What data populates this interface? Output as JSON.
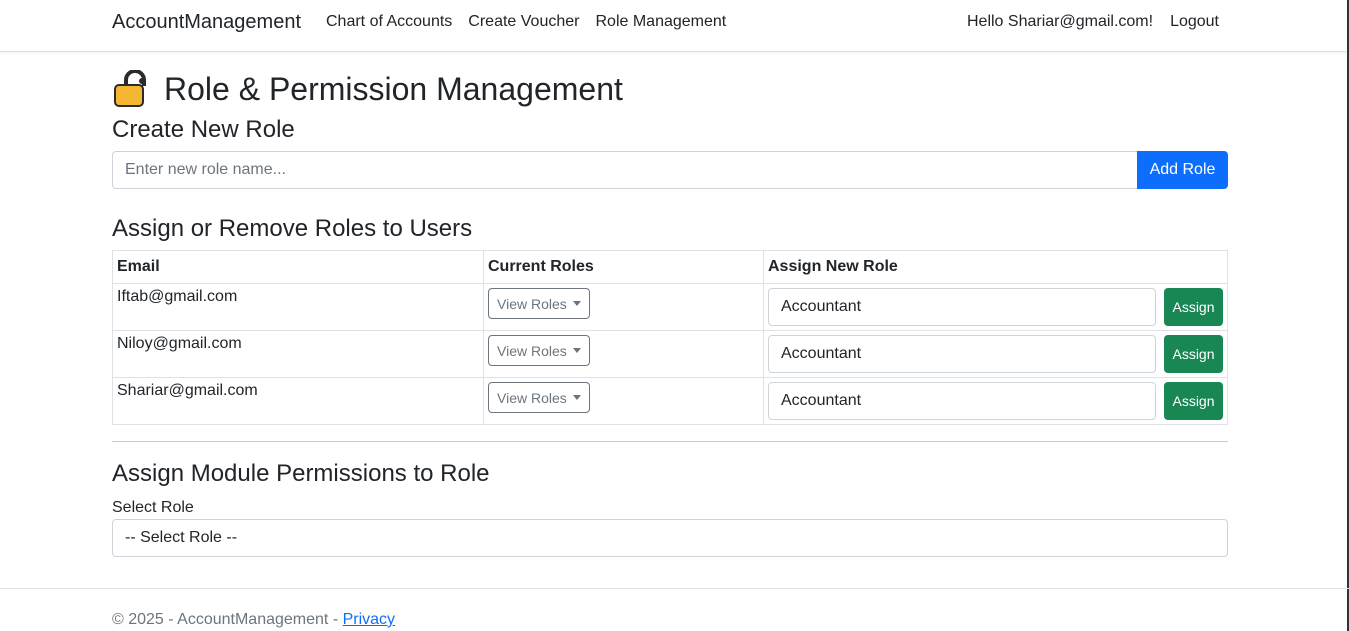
{
  "nav": {
    "brand": "AccountManagement",
    "links": [
      "Chart of Accounts",
      "Create Voucher",
      "Role Management"
    ],
    "greeting": "Hello Shariar@gmail.com!",
    "logout": "Logout"
  },
  "page": {
    "title": "Role & Permission Management",
    "icon": "lock-icon"
  },
  "create_role": {
    "heading": "Create New Role",
    "placeholder": "Enter new role name...",
    "button": "Add Role"
  },
  "assign": {
    "heading": "Assign or Remove Roles to Users",
    "columns": [
      "Email",
      "Current Roles",
      "Assign New Role"
    ],
    "rows": [
      {
        "email": "Iftab@gmail.com",
        "roles_button": "View Roles",
        "selected_role": "Accountant",
        "assign_button": "Assign"
      },
      {
        "email": "Niloy@gmail.com",
        "roles_button": "View Roles",
        "selected_role": "Accountant",
        "assign_button": "Assign"
      },
      {
        "email": "Shariar@gmail.com",
        "roles_button": "View Roles",
        "selected_role": "Accountant",
        "assign_button": "Assign"
      }
    ]
  },
  "permissions": {
    "heading": "Assign Module Permissions to Role",
    "label": "Select Role",
    "selected": "-- Select Role --"
  },
  "footer": {
    "text": "© 2025 - AccountManagement - ",
    "link": "Privacy"
  },
  "colors": {
    "primary": "#0d6efd",
    "success": "#198754",
    "lock_body": "#f5b731",
    "lock_shackle": "#2b2b2b"
  }
}
